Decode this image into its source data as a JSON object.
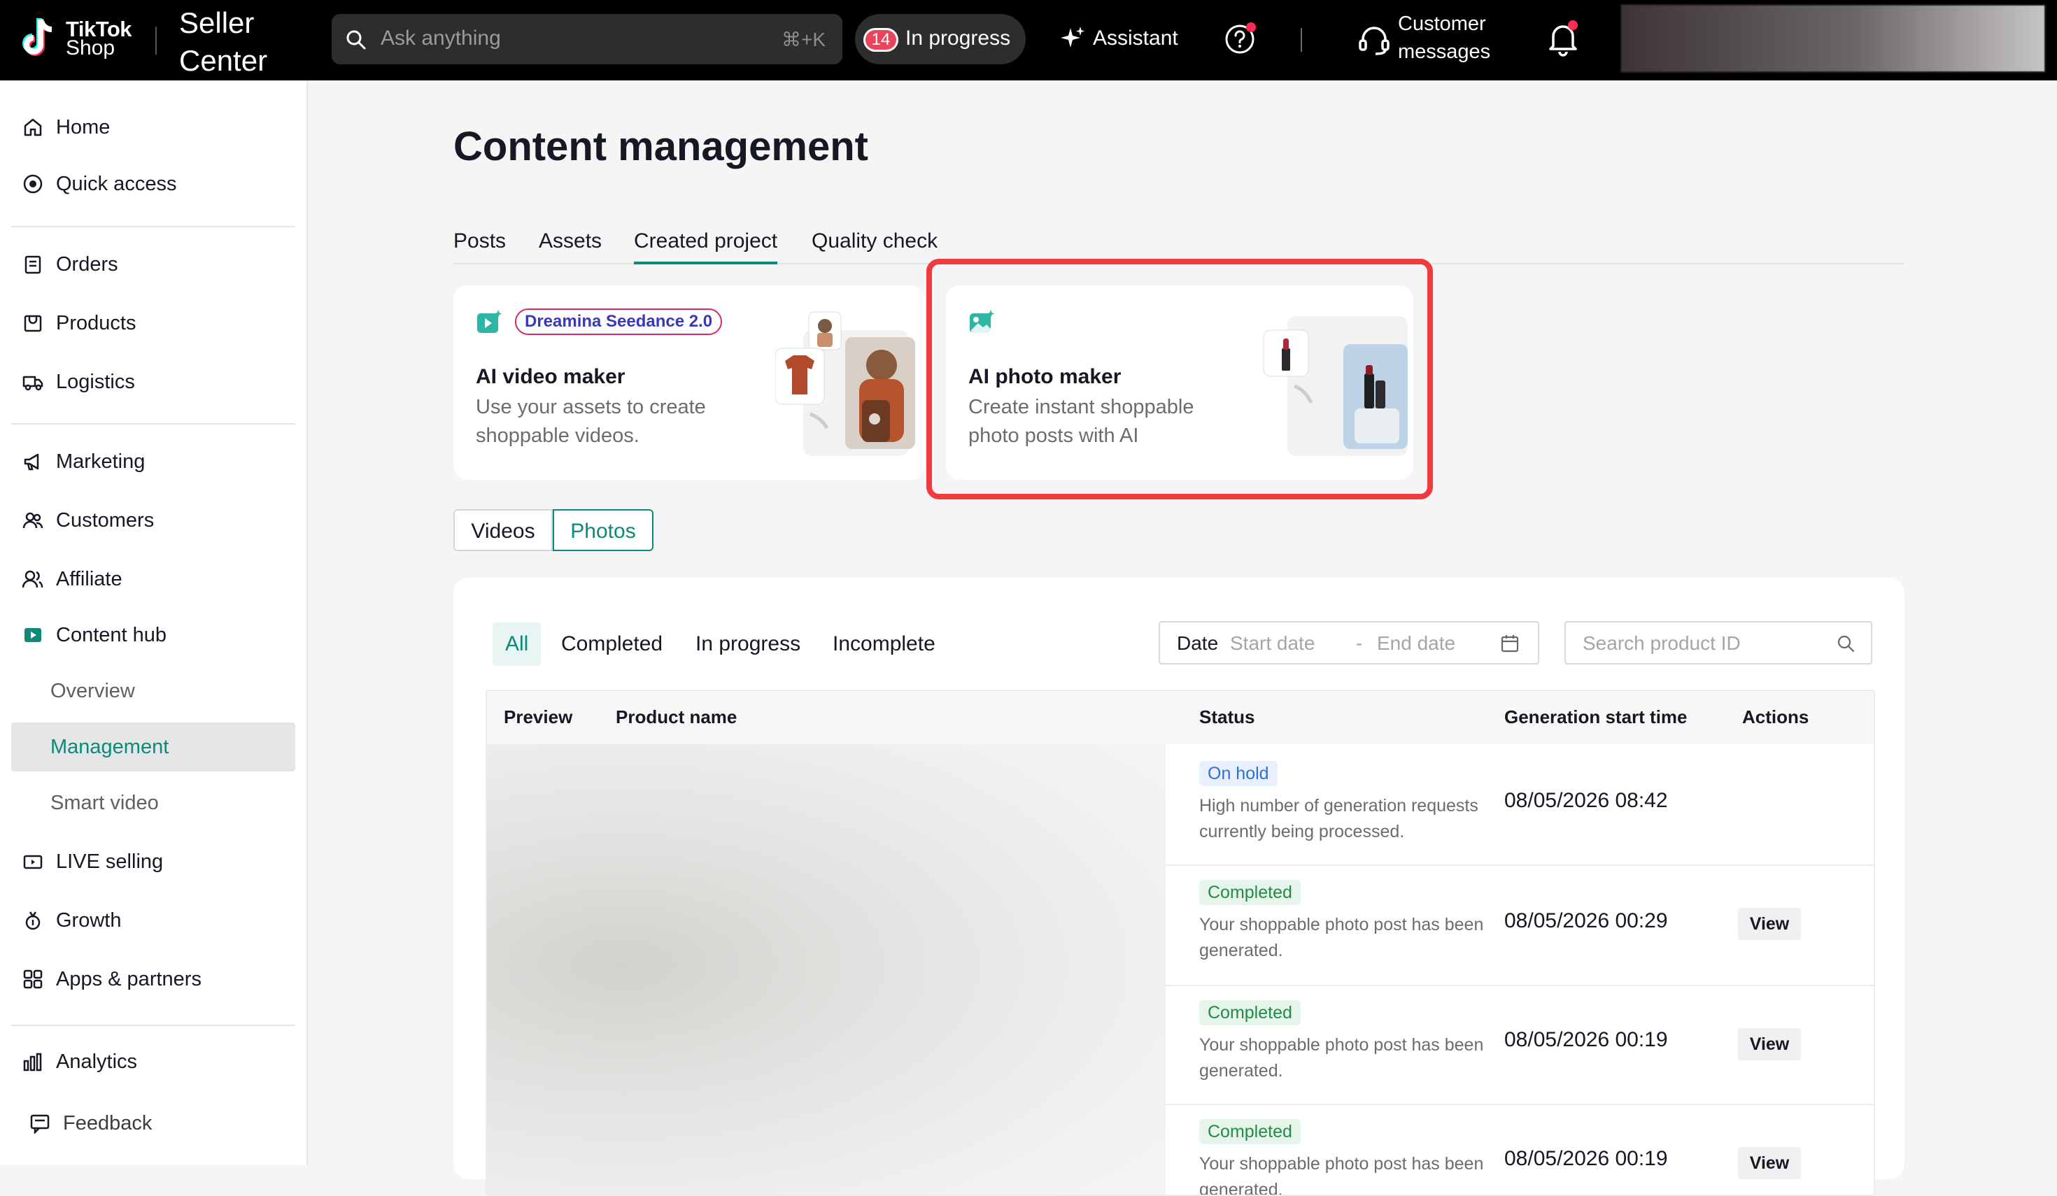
{
  "topbar": {
    "logo_line1": "TikTok",
    "logo_line2": "Shop",
    "title_line1": "Seller",
    "title_line2": "Center",
    "search_placeholder": "Ask anything",
    "search_shortcut": "⌘+K",
    "in_progress_count": "14",
    "in_progress_label": "In progress",
    "assistant_label": "Assistant",
    "cs_line1": "Customer",
    "cs_line2": "messages"
  },
  "sidebar": {
    "items": [
      {
        "label": "Home",
        "icon": "home-icon"
      },
      {
        "label": "Quick access",
        "icon": "quick-access-icon"
      },
      {
        "label": "Orders",
        "icon": "orders-icon"
      },
      {
        "label": "Products",
        "icon": "products-icon"
      },
      {
        "label": "Logistics",
        "icon": "truck-icon"
      },
      {
        "label": "Marketing",
        "icon": "megaphone-icon"
      },
      {
        "label": "Customers",
        "icon": "customers-icon"
      },
      {
        "label": "Affiliate",
        "icon": "affiliate-icon"
      },
      {
        "label": "Content hub",
        "icon": "content-hub-icon"
      },
      {
        "label": "Overview"
      },
      {
        "label": "Management"
      },
      {
        "label": "Smart video"
      },
      {
        "label": "LIVE selling",
        "icon": "live-icon"
      },
      {
        "label": "Growth",
        "icon": "growth-icon"
      },
      {
        "label": "Apps & partners",
        "icon": "apps-icon"
      },
      {
        "label": "Analytics",
        "icon": "analytics-icon"
      },
      {
        "label": "Feedback",
        "icon": "feedback-icon"
      }
    ]
  },
  "main": {
    "title": "Content management",
    "tabs": [
      "Posts",
      "Assets",
      "Created project",
      "Quality check"
    ],
    "active_tab": "Created project",
    "cards": [
      {
        "pill": "Dreamina Seedance 2.0",
        "title": "AI video maker",
        "desc": "Use your assets to create shoppable videos."
      },
      {
        "title": "AI photo maker",
        "desc": "Create instant shoppable photo posts with AI"
      }
    ],
    "media_toggle": [
      "Videos",
      "Photos"
    ],
    "filters": [
      "All",
      "Completed",
      "In progress",
      "Incomplete"
    ],
    "date_label": "Date",
    "date_start_placeholder": "Start date",
    "date_sep": "-",
    "date_end_placeholder": "End date",
    "product_search_placeholder": "Search product ID",
    "table_headers": [
      "Preview",
      "Product name",
      "Status",
      "Generation start time",
      "Actions"
    ],
    "rows": [
      {
        "status": "On hold",
        "desc": "High number of generation requests currently being processed.",
        "time": "08/05/2026 08:42",
        "action": ""
      },
      {
        "status": "Completed",
        "desc": "Your shoppable photo post has been generated.",
        "time": "08/05/2026 00:29",
        "action": "View"
      },
      {
        "status": "Completed",
        "desc": "Your shoppable photo post has been generated.",
        "time": "08/05/2026 00:19",
        "action": "View"
      },
      {
        "status": "Completed",
        "desc": "Your shoppable photo post has been generated.",
        "time": "08/05/2026 00:19",
        "action": "View"
      }
    ]
  },
  "colors": {
    "accent": "#0b8a7a",
    "highlight": "#ef3b3f",
    "badge_red": "#e8455a"
  }
}
